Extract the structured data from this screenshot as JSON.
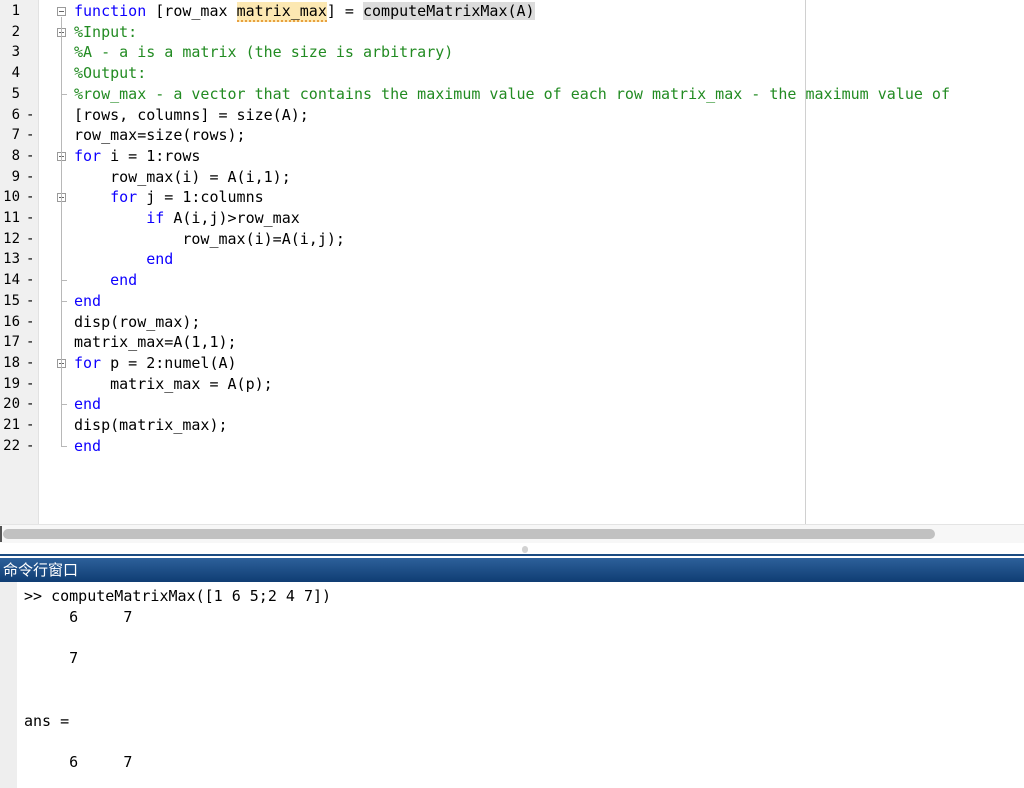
{
  "editor": {
    "lines": [
      {
        "num": "1",
        "breakpoint": "",
        "segments": [
          {
            "t": "function",
            "c": "kw"
          },
          {
            "t": " [row_max ",
            "c": ""
          },
          {
            "t": "matrix_max",
            "c": "hl-var"
          },
          {
            "t": "] = ",
            "c": ""
          },
          {
            "t": "computeMatrixMax(A)",
            "c": "hl-fn"
          }
        ]
      },
      {
        "num": "2",
        "breakpoint": "",
        "segments": [
          {
            "t": "%Input:",
            "c": "cm"
          }
        ]
      },
      {
        "num": "3",
        "breakpoint": "",
        "segments": [
          {
            "t": "%A - a is a matrix (the size is arbitrary)",
            "c": "cm"
          }
        ]
      },
      {
        "num": "4",
        "breakpoint": "",
        "segments": [
          {
            "t": "%Output:",
            "c": "cm"
          }
        ]
      },
      {
        "num": "5",
        "breakpoint": "",
        "segments": [
          {
            "t": "%row_max - a vector that contains the maximum value of each row matrix_max - the maximum value of",
            "c": "cm"
          }
        ]
      },
      {
        "num": "6",
        "breakpoint": "-",
        "segments": [
          {
            "t": "[rows, columns] = size(A);",
            "c": ""
          }
        ]
      },
      {
        "num": "7",
        "breakpoint": "-",
        "segments": [
          {
            "t": "row_max=size(rows);",
            "c": ""
          }
        ]
      },
      {
        "num": "8",
        "breakpoint": "-",
        "segments": [
          {
            "t": "for",
            "c": "kw"
          },
          {
            "t": " i = 1:rows",
            "c": ""
          }
        ]
      },
      {
        "num": "9",
        "breakpoint": "-",
        "segments": [
          {
            "t": "    row_max(i) = A(i,1);",
            "c": ""
          }
        ]
      },
      {
        "num": "10",
        "breakpoint": "-",
        "segments": [
          {
            "t": "    ",
            "c": ""
          },
          {
            "t": "for",
            "c": "kw"
          },
          {
            "t": " j = 1:columns",
            "c": ""
          }
        ]
      },
      {
        "num": "11",
        "breakpoint": "-",
        "segments": [
          {
            "t": "        ",
            "c": ""
          },
          {
            "t": "if",
            "c": "kw"
          },
          {
            "t": " A(i,j)>row_max",
            "c": ""
          }
        ]
      },
      {
        "num": "12",
        "breakpoint": "-",
        "segments": [
          {
            "t": "            row_max(i)=A(i,j);",
            "c": ""
          }
        ]
      },
      {
        "num": "13",
        "breakpoint": "-",
        "segments": [
          {
            "t": "        ",
            "c": ""
          },
          {
            "t": "end",
            "c": "kw"
          }
        ]
      },
      {
        "num": "14",
        "breakpoint": "-",
        "segments": [
          {
            "t": "    ",
            "c": ""
          },
          {
            "t": "end",
            "c": "kw"
          }
        ]
      },
      {
        "num": "15",
        "breakpoint": "-",
        "segments": [
          {
            "t": "end",
            "c": "kw"
          }
        ]
      },
      {
        "num": "16",
        "breakpoint": "-",
        "segments": [
          {
            "t": "disp(row_max);",
            "c": ""
          }
        ]
      },
      {
        "num": "17",
        "breakpoint": "-",
        "segments": [
          {
            "t": "matrix_max=A(1,1);",
            "c": ""
          }
        ]
      },
      {
        "num": "18",
        "breakpoint": "-",
        "segments": [
          {
            "t": "for",
            "c": "kw"
          },
          {
            "t": " p = 2:numel(A)",
            "c": ""
          }
        ]
      },
      {
        "num": "19",
        "breakpoint": "-",
        "segments": [
          {
            "t": "    matrix_max = A(p);",
            "c": ""
          }
        ]
      },
      {
        "num": "20",
        "breakpoint": "-",
        "segments": [
          {
            "t": "end",
            "c": "kw"
          }
        ]
      },
      {
        "num": "21",
        "breakpoint": "-",
        "segments": [
          {
            "t": "disp(matrix_max);",
            "c": ""
          }
        ]
      },
      {
        "num": "22",
        "breakpoint": "-",
        "segments": [
          {
            "t": "end",
            "c": "kw"
          }
        ]
      }
    ]
  },
  "command_window": {
    "title": "命令行窗口",
    "output": [
      ">> computeMatrixMax([1 6 5;2 4 7])",
      "     6     7",
      "",
      "     7",
      "",
      "",
      "ans =",
      "",
      "     6     7"
    ]
  }
}
